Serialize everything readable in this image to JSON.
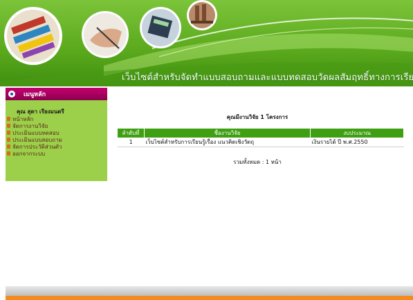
{
  "header": {
    "site_title": "เว็บไซต์สำหรับจัดทำแบบสอบถามและแบบทดสอบวัดผลสัมฤทธิ์ทางการเรียน"
  },
  "sidebar": {
    "menu_title": "เมนูหลัก",
    "user_name": "คุณ สุดา เรียงมนตรี",
    "items": [
      {
        "label": "หน้าหลัก"
      },
      {
        "label": "จัดการงานวิจัย"
      },
      {
        "label": "ประเมินแบบทดสอบ"
      },
      {
        "label": "ประเมินแบบสอบถาม"
      },
      {
        "label": "จัดการประวัติส่วนตัว"
      },
      {
        "label": "ออกจากระบบ"
      }
    ]
  },
  "main": {
    "title": "คุณมีงานวิจัย 1 โครงการ",
    "table": {
      "headers": [
        "ลำดับที่",
        "ชื่องานวิจัย",
        "งบประมาณ"
      ],
      "rows": [
        {
          "no": "1",
          "name": "เว็บไซต์สำหรับการเรียนรู้เรื่อง แนวคิดเชิงวัตถุ",
          "budget": "เงินรายได้ ปี พ.ศ.2550"
        }
      ]
    },
    "pager": "รวมทั้งหมด : 1 หน้า"
  },
  "colors": {
    "banner_green": "#5aa81c",
    "menu_header": "#b0006a",
    "sidebar_bg": "#9ccf4a",
    "table_header": "#3f9f12",
    "footer_accent": "#f58a1f"
  }
}
